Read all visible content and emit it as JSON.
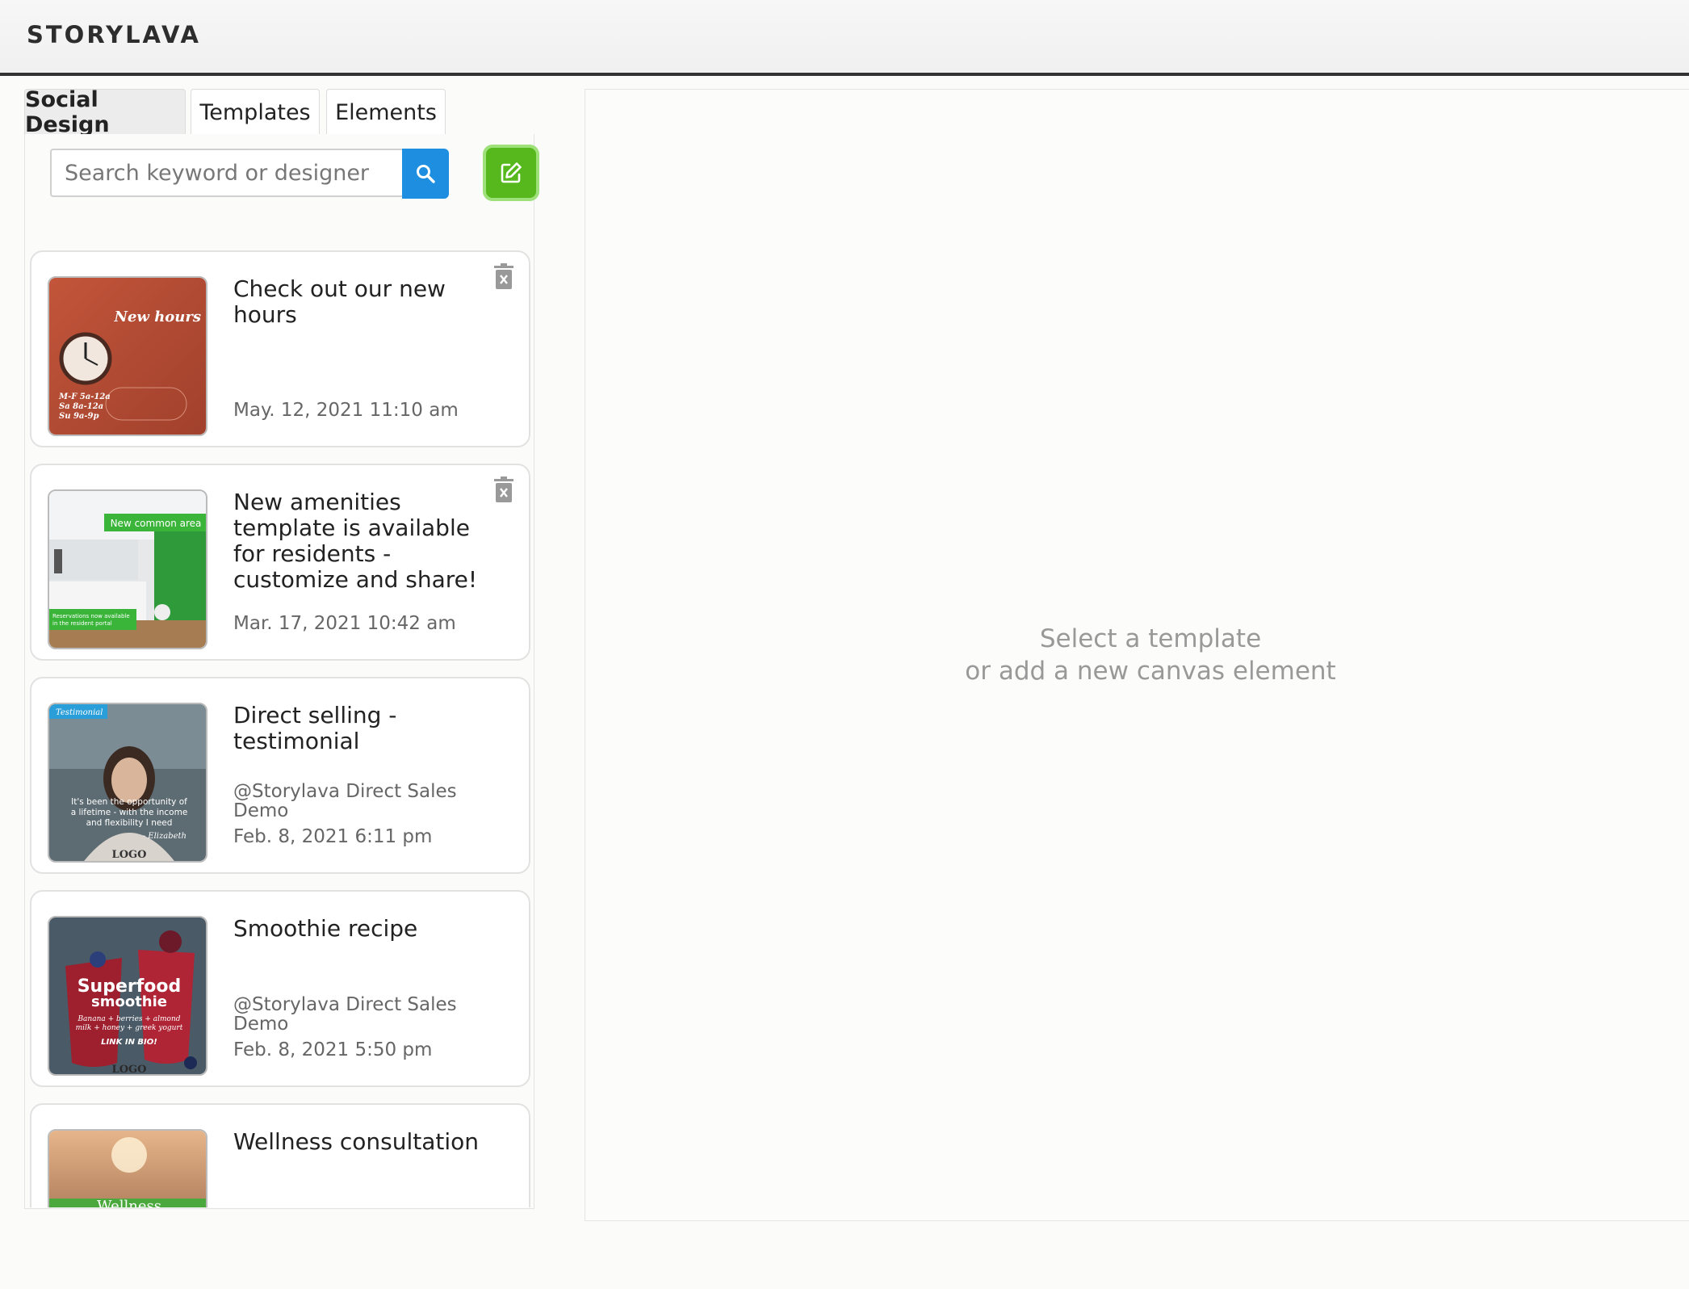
{
  "header": {
    "brand": "STORYLAVA"
  },
  "tabs": [
    {
      "label": "Social Design",
      "active": true
    },
    {
      "label": "Templates",
      "active": false
    },
    {
      "label": "Elements",
      "active": false
    }
  ],
  "search": {
    "placeholder": "Search keyword or designer",
    "value": "",
    "search_icon": "search-icon",
    "edit_icon": "edit-icon"
  },
  "colors": {
    "accent_blue": "#1e8fe0",
    "accent_green": "#56b81c"
  },
  "designs": [
    {
      "title": "Check out our new hours",
      "designer": "",
      "date": "May. 12, 2021 11:10 am",
      "deletable": true,
      "thumb_text": [
        "New hours",
        "M-F 5a-12a",
        "Sa 8a-12a",
        "Su 9a-9p"
      ]
    },
    {
      "title": "New amenities template is available for residents - customize and share!",
      "designer": "",
      "date": "Mar. 17, 2021 10:42 am",
      "deletable": true,
      "thumb_text": [
        "New common area",
        "Reservations now available",
        "in the resident portal"
      ]
    },
    {
      "title": "Direct selling - testimonial",
      "designer": "@Storylava Direct Sales Demo",
      "date": "Feb. 8, 2021 6:11 pm",
      "deletable": false,
      "thumb_text": [
        "Testimonial",
        "It's been the opportunity of",
        "a lifetime - with the income",
        "and flexibility I need",
        "- Elizabeth",
        "LOGO"
      ]
    },
    {
      "title": "Smoothie recipe",
      "designer": "@Storylava Direct Sales Demo",
      "date": "Feb. 8, 2021 5:50 pm",
      "deletable": false,
      "thumb_text": [
        "Superfood",
        "smoothie",
        "Banana + berries + almond",
        "milk + honey + greek yogurt",
        "LINK IN BIO!",
        "LOGO"
      ]
    },
    {
      "title": "Wellness consultation",
      "designer": "",
      "date": "",
      "deletable": false,
      "thumb_text": [
        "Wellness"
      ]
    }
  ],
  "canvas": {
    "line1": "Select a template",
    "line2": "or add a new canvas element"
  }
}
